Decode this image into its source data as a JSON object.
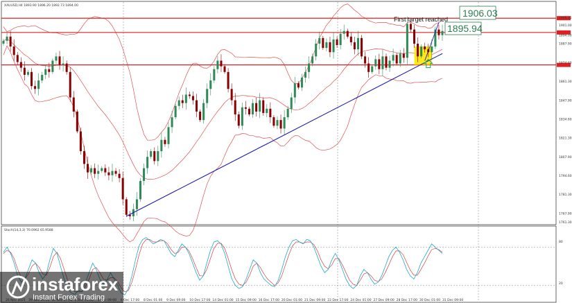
{
  "header": {
    "symbol_line": "XAUUSD,H4  1893.90 1896.20 1892.73 1894.00"
  },
  "oscillator": {
    "label": "Stoch(14,3,3) 70.0962 65.9588",
    "levels": [
      "80",
      "20"
    ]
  },
  "annotations": {
    "first_target": "First target reached",
    "level_top": "1906.03",
    "level_mid": "1895.94"
  },
  "brand": {
    "name": "instaforex",
    "tagline": "Instant Forex Trading"
  },
  "colors": {
    "bull": "#2e8b57",
    "bear": "#8b0000",
    "band": "#e05050",
    "trend": "#1a1aa8",
    "hline": "#e02020",
    "highlight": "#ffe600",
    "stoch_main": "#1fa8c8",
    "stoch_signal": "#d04040"
  },
  "chart_data": {
    "type": "candlestick",
    "title": "XAUUSD,H4",
    "ylim": [
      1763.0,
      1913.0
    ],
    "price_ticks": [
      "1906.35",
      "1901.00",
      "1894.00",
      "1887.90",
      "1874.60",
      "1861.30",
      "1847.90",
      "1834.60",
      "1821.30",
      "1807.90",
      "1794.60",
      "1781.30",
      "1767.90",
      "1761.30"
    ],
    "time_labels": [
      "26 Nov 2021",
      "29 Nov 09:00",
      "30 Nov 17:00",
      "2 Dec 01:00",
      "3 Dec 09:00",
      "6 Dec 17:00",
      "8 Dec 01:00",
      "9 Dec 09:00",
      "10 Dec 17:00",
      "14 Dec 01:00",
      "15 Dec 09:00",
      "16 Dec 17:00",
      "20 Dec 01:00",
      "21 Dec 09:00",
      "22 Dec 17:00",
      "24 Dec 01:00",
      "27 Dec 09:00",
      "28 Dec 17:00",
      "30 Dec 01:00",
      "31 Dec 09:00"
    ],
    "horizontal_levels": [
      1906.03,
      1895.94,
      1873.0
    ],
    "close": [
      1890,
      1893,
      1886,
      1880,
      1875,
      1871,
      1866,
      1868,
      1858,
      1856,
      1862,
      1866,
      1870,
      1868,
      1876,
      1879,
      1873,
      1874,
      1868,
      1850,
      1840,
      1826,
      1812,
      1803,
      1797,
      1800,
      1796,
      1798,
      1800,
      1797,
      1795,
      1798,
      1796,
      1793,
      1778,
      1767,
      1766,
      1771,
      1778,
      1791,
      1800,
      1808,
      1812,
      1805,
      1812,
      1820,
      1817,
      1829,
      1836,
      1844,
      1848,
      1846,
      1852,
      1851,
      1848,
      1840,
      1834,
      1846,
      1856,
      1862,
      1870,
      1876,
      1872,
      1868,
      1856,
      1848,
      1838,
      1830,
      1843,
      1842,
      1838,
      1846,
      1840,
      1848,
      1839,
      1842,
      1836,
      1830,
      1834,
      1828,
      1836,
      1842,
      1850,
      1860,
      1857,
      1864,
      1868,
      1874,
      1879,
      1888,
      1892,
      1885,
      1889,
      1882,
      1891,
      1887,
      1895,
      1897,
      1893,
      1889,
      1884,
      1892,
      1879,
      1874,
      1868,
      1872,
      1877,
      1870,
      1879,
      1871,
      1876,
      1880,
      1874,
      1881,
      1878,
      1902,
      1898,
      1888,
      1879,
      1886,
      1884,
      1882,
      1886,
      1898,
      1894,
      1897
    ],
    "stochastic": {
      "main": [
        72,
        80,
        70,
        55,
        35,
        25,
        30,
        45,
        60,
        55,
        40,
        30,
        38,
        60,
        78,
        70,
        50,
        30,
        15,
        8,
        6,
        12,
        10,
        25,
        40,
        55,
        45,
        30,
        22,
        28,
        40,
        30,
        20,
        8,
        5,
        15,
        35,
        60,
        82,
        92,
        95,
        90,
        85,
        88,
        92,
        90,
        80,
        70,
        65,
        75,
        85,
        80,
        70,
        55,
        40,
        28,
        35,
        55,
        75,
        88,
        90,
        85,
        70,
        50,
        30,
        20,
        15,
        18,
        30,
        45,
        60,
        55,
        40,
        30,
        25,
        20,
        18,
        28,
        45,
        65,
        80,
        90,
        92,
        88,
        85,
        92,
        90,
        80,
        65,
        50,
        40,
        45,
        60,
        70,
        60,
        45,
        30,
        20,
        15,
        20,
        35,
        45,
        40,
        30,
        22,
        25,
        35,
        50,
        65,
        75,
        80,
        72,
        60,
        45,
        35,
        30,
        40,
        55,
        65,
        75,
        85,
        80,
        75,
        70
      ],
      "signal": [
        70,
        75,
        72,
        62,
        45,
        32,
        30,
        38,
        50,
        55,
        48,
        38,
        36,
        48,
        65,
        72,
        62,
        45,
        28,
        15,
        10,
        10,
        10,
        18,
        30,
        45,
        48,
        40,
        30,
        28,
        32,
        32,
        26,
        16,
        10,
        12,
        25,
        45,
        68,
        85,
        92,
        92,
        88,
        88,
        90,
        90,
        85,
        76,
        70,
        72,
        80,
        80,
        74,
        62,
        48,
        35,
        35,
        45,
        62,
        78,
        86,
        86,
        78,
        62,
        44,
        30,
        22,
        20,
        25,
        36,
        50,
        55,
        48,
        38,
        30,
        25,
        20,
        24,
        35,
        52,
        68,
        82,
        88,
        88,
        86,
        88,
        88,
        84,
        74,
        60,
        50,
        46,
        52,
        62,
        62,
        52,
        40,
        28,
        22,
        20,
        28,
        38,
        40,
        35,
        28,
        26,
        30,
        40,
        52,
        65,
        74,
        74,
        68,
        56,
        44,
        36,
        36,
        45,
        55,
        66,
        76,
        78,
        76,
        72
      ]
    }
  }
}
